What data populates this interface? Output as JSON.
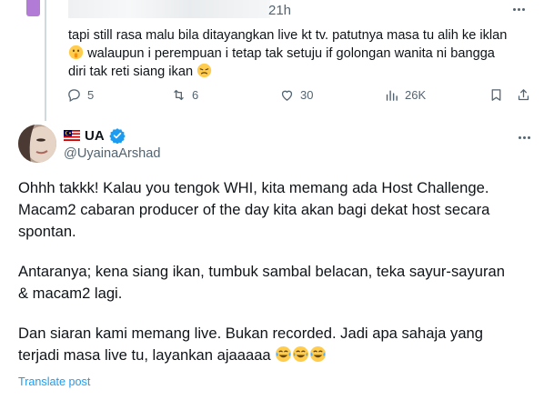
{
  "parent_tweet": {
    "time": "21h",
    "text_lines": [
      "tapi still rasa malu bila ditayangkan live kt tv. patutnya masa tu alih ke iklan",
      "walaupun i perempuan i tetap tak setuju if golongan wanita ni bangga",
      "diri tak reti siang ikan"
    ],
    "actions": {
      "replies": "5",
      "reposts": "6",
      "likes": "30",
      "views": "26K"
    },
    "icons": [
      "more-icon",
      "reply-icon",
      "repost-icon",
      "like-icon",
      "views-icon",
      "bookmark-icon",
      "share-icon"
    ]
  },
  "main_tweet": {
    "display_name": "UA",
    "handle": "@UyainaArshad",
    "paragraphs": [
      [
        "Ohhh takkk! Kalau you tengok WHI, kita memang ada Host Challenge.",
        "Macam2 cabaran producer of the day kita akan bagi dekat host secara",
        "spontan."
      ],
      [
        "Antaranya; kena siang ikan, tumbuk sambal belacan, teka sayur-sayuran",
        "& macam2 lagi."
      ],
      [
        "Dan siaran kami memang live. Bukan recorded. Jadi apa sahaja yang",
        "terjadi masa live tu, layankan ajaaaaa"
      ]
    ],
    "translate_label": "Translate post",
    "icons": [
      "malaysia-flag-icon",
      "verified-badge-icon",
      "more-icon",
      "laughing-crying-emoji"
    ]
  },
  "colors": {
    "text": "#0f1419",
    "secondary": "#536471",
    "link": "#1d9bf0",
    "verified": "#1d9bf0",
    "thread_line": "#cfd9de"
  }
}
